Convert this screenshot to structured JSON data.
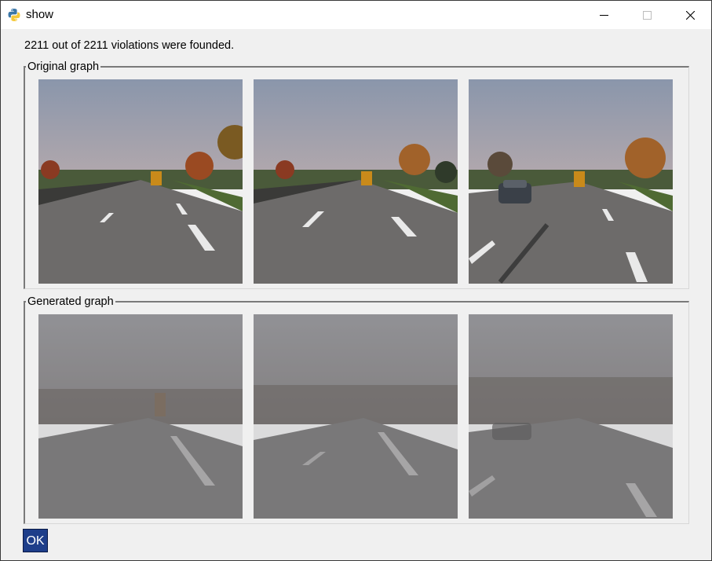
{
  "window": {
    "title": "show",
    "controls": {
      "minimize_icon": "minimize-icon",
      "maximize_icon": "maximize-icon",
      "close_icon": "close-icon"
    }
  },
  "status": {
    "message": "2211 out of 2211 violations were founded."
  },
  "groups": {
    "original": {
      "legend": "Original graph",
      "images": [
        {
          "scene": "highway-clear",
          "description_icon": "road-photo"
        },
        {
          "scene": "highway-clear",
          "description_icon": "road-photo"
        },
        {
          "scene": "highway-clear-car",
          "description_icon": "road-photo"
        }
      ]
    },
    "generated": {
      "legend": "Generated graph",
      "images": [
        {
          "scene": "highway-rain",
          "description_icon": "road-photo"
        },
        {
          "scene": "highway-rain",
          "description_icon": "road-photo"
        },
        {
          "scene": "highway-rain",
          "description_icon": "road-photo"
        }
      ]
    }
  },
  "ok_button": {
    "label": "OK"
  },
  "colors": {
    "ok_button_bg": "#1e3e8a",
    "window_bg": "#f0f0f0",
    "titlebar_bg": "#ffffff"
  }
}
